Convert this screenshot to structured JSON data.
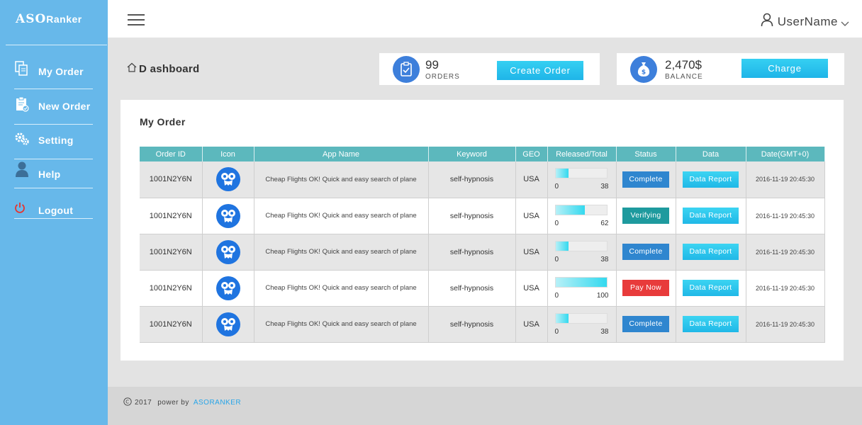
{
  "brand": {
    "logo_big": "ASO",
    "logo_small": "Ranker"
  },
  "sidebar": {
    "items": [
      {
        "label": "My Order",
        "icon": "copy-icon"
      },
      {
        "label": "New Order",
        "icon": "clipboard-check-icon"
      },
      {
        "label": "Setting",
        "icon": "gears-icon"
      },
      {
        "label": "Help",
        "icon": "user-icon"
      },
      {
        "label": "Logout",
        "icon": "power-icon"
      }
    ]
  },
  "header": {
    "username": "UserName"
  },
  "dashboard": {
    "title": "ashboard",
    "title_first": "D"
  },
  "stats": {
    "orders": {
      "value": "99",
      "caption": "ORDERS",
      "button": "Create  Order"
    },
    "balance": {
      "value": "2,470$",
      "caption": "BALANCE",
      "button": "Charge"
    }
  },
  "orders_panel": {
    "title": "My Order",
    "columns": [
      "Order ID",
      "Icon",
      "App Name",
      "Keyword",
      "GEO",
      "Released/Total",
      "Status",
      "Data",
      "Date(GMT+0)"
    ],
    "rows": [
      {
        "id": "1001N2Y6N",
        "app": "Cheap Flights OK! Quick and easy search of plane",
        "keyword": "self-hypnosis",
        "geo": "USA",
        "released": "0",
        "total": "38",
        "progress": 0.25,
        "status": "Complete",
        "data": "Data Report",
        "date": "2016-11-19 20:45:30"
      },
      {
        "id": "1001N2Y6N",
        "app": "Cheap Flights OK! Quick and easy search of plane",
        "keyword": "self-hypnosis",
        "geo": "USA",
        "released": "0",
        "total": "62",
        "progress": 0.58,
        "status": "Verifying",
        "data": "Data Report",
        "date": "2016-11-19 20:45:30"
      },
      {
        "id": "1001N2Y6N",
        "app": "Cheap Flights OK! Quick and easy search of plane",
        "keyword": "self-hypnosis",
        "geo": "USA",
        "released": "0",
        "total": "38",
        "progress": 0.25,
        "status": "Complete",
        "data": "Data Report",
        "date": "2016-11-19 20:45:30"
      },
      {
        "id": "1001N2Y6N",
        "app": "Cheap Flights OK! Quick and easy search of plane",
        "keyword": "self-hypnosis",
        "geo": "USA",
        "released": "0",
        "total": "100",
        "progress": 1.0,
        "status": "Pay Now",
        "data": "Data Report",
        "date": "2016-11-19 20:45:30"
      },
      {
        "id": "1001N2Y6N",
        "app": "Cheap Flights OK! Quick and easy search of plane",
        "keyword": "self-hypnosis",
        "geo": "USA",
        "released": "0",
        "total": "38",
        "progress": 0.25,
        "status": "Complete",
        "data": "Data Report",
        "date": "2016-11-19 20:45:30"
      }
    ]
  },
  "status_colors": {
    "Complete": "#2f86cf",
    "Verifying": "#1e9a9e",
    "Pay Now": "#e83b3b"
  },
  "footer": {
    "copyright": "2017",
    "powered": "power by",
    "link": "ASORANKER"
  }
}
